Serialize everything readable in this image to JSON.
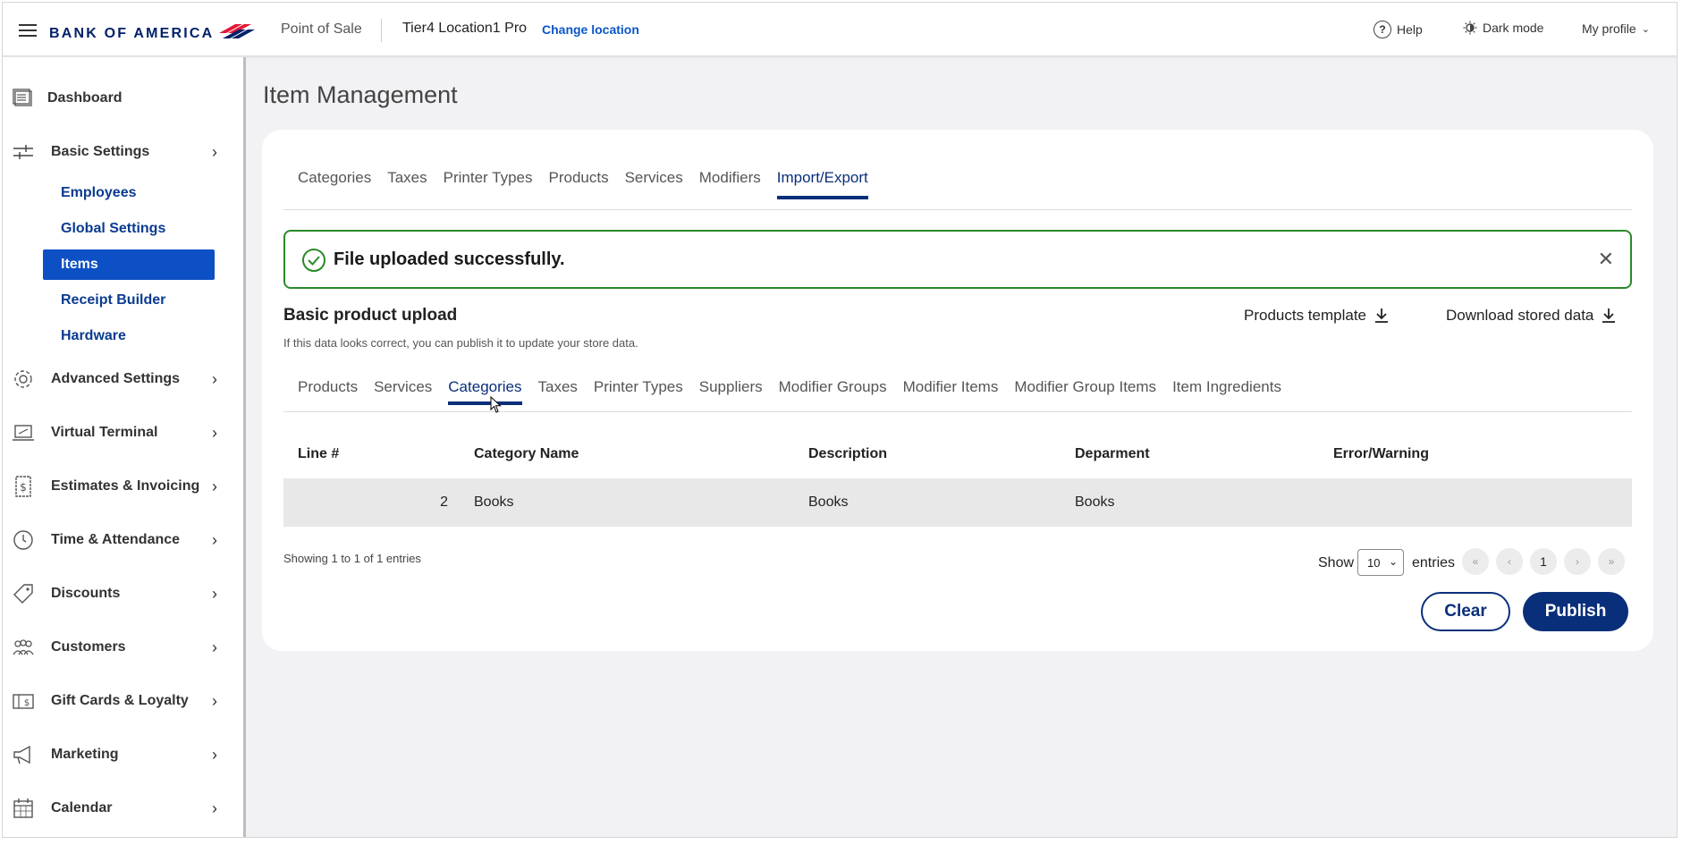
{
  "header": {
    "logo_text": "BANK OF AMERICA",
    "app_name": "Point of Sale",
    "location": "Tier4 Location1 Pro",
    "change_location": "Change location",
    "help": "Help",
    "dark_mode": "Dark mode",
    "profile": "My profile"
  },
  "sidebar": {
    "dashboard": "Dashboard",
    "basic_settings": "Basic Settings",
    "sub_items": [
      "Employees",
      "Global Settings",
      "Items",
      "Receipt Builder",
      "Hardware"
    ],
    "active_sub_item": "Items",
    "sections": [
      "Advanced Settings",
      "Virtual Terminal",
      "Estimates & Invoicing",
      "Time & Attendance",
      "Discounts",
      "Customers",
      "Gift Cards & Loyalty",
      "Marketing",
      "Calendar"
    ]
  },
  "main": {
    "page_title": "Item Management",
    "tabs": [
      "Categories",
      "Taxes",
      "Printer Types",
      "Products",
      "Services",
      "Modifiers",
      "Import/Export"
    ],
    "active_tab": "Import/Export",
    "alert": "File uploaded successfully.",
    "section_title": "Basic product upload",
    "section_subtitle": "If this data looks correct, you can publish it to update your store data.",
    "products_template": "Products template",
    "download_stored": "Download stored data",
    "subtabs": [
      "Products",
      "Services",
      "Categories",
      "Taxes",
      "Printer Types",
      "Suppliers",
      "Modifier Groups",
      "Modifier Items",
      "Modifier Group Items",
      "Item Ingredients"
    ],
    "active_subtab": "Categories",
    "table": {
      "headers": [
        "Line #",
        "Category Name",
        "Description",
        "Deparment",
        "Error/Warning"
      ],
      "rows": [
        {
          "line": "2",
          "category_name": "Books",
          "description": "Books",
          "department": "Books",
          "error": ""
        }
      ]
    },
    "showing": "Showing 1 to 1 of 1 entries",
    "show_label": "Show",
    "show_value": "10",
    "entries_label": "entries",
    "pagination": [
      "«",
      "‹",
      "1",
      "›",
      "»"
    ],
    "clear": "Clear",
    "publish": "Publish"
  },
  "colors": {
    "brand_navy": "#012169",
    "accent_blue": "#0d4fc4",
    "primary_button": "#0a2f7a",
    "success_green": "#2a8a2a"
  }
}
